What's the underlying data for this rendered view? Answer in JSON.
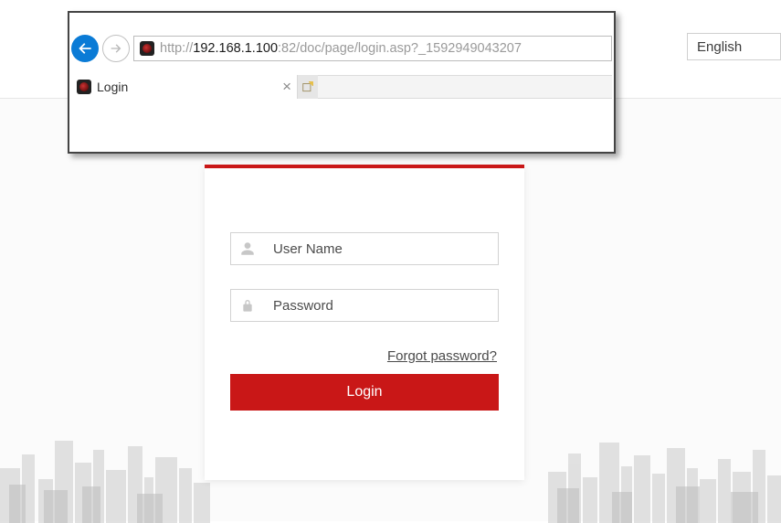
{
  "browser": {
    "url_prefix": "http://",
    "url_host": "192.168.1.100",
    "url_rest": ":82/doc/page/login.asp?_1592949043207",
    "tab_title": "Login"
  },
  "header": {
    "language": "English"
  },
  "login": {
    "username_placeholder": "User Name",
    "password_placeholder": "Password",
    "forgot_label": "Forgot password?",
    "login_button_label": "Login"
  }
}
